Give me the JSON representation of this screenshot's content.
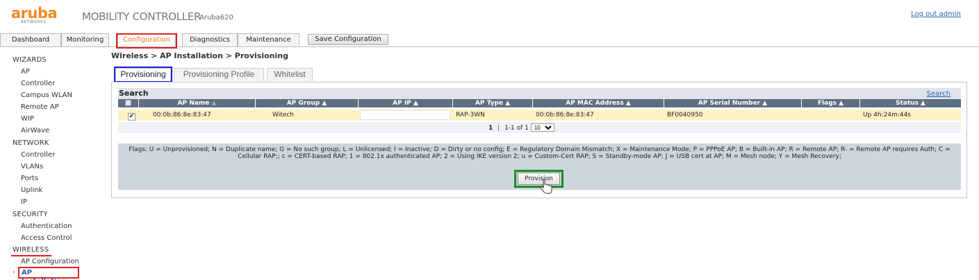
{
  "header": {
    "logo_text": "aruba",
    "logo_subtext": "NETWORKS",
    "product": "MOBILITY CONTROLLER",
    "separator": "|",
    "hostname": "Aruba620",
    "logout": "Log out admin"
  },
  "top_tabs": [
    "Dashboard",
    "Monitoring",
    "Configuration",
    "Diagnostics",
    "Maintenance"
  ],
  "save_button": "Save Configuration",
  "sidebar": {
    "wizards": {
      "title": "WIZARDS",
      "items": [
        "AP",
        "Controller",
        "Campus WLAN",
        "Remote AP",
        "WIP",
        "AirWave"
      ]
    },
    "network": {
      "title": "NETWORK",
      "items": [
        "Controller",
        "VLANs",
        "Ports",
        "Uplink",
        "IP"
      ]
    },
    "security": {
      "title": "SECURITY",
      "items": [
        "Authentication",
        "Access Control"
      ]
    },
    "wireless": {
      "title": "WIRELESS",
      "items": [
        "AP Configuration",
        "AP Installation"
      ]
    },
    "active_arrow": "›"
  },
  "breadcrumb": "Wireless > AP Installation > Provisioning",
  "sub_tabs": [
    "Provisioning",
    "Provisioning Profile",
    "Whitelist"
  ],
  "search": {
    "title": "Search",
    "link": "Search"
  },
  "table": {
    "columns": [
      "AP Name",
      "AP Group ▲",
      "AP IP ▲",
      "AP Type ▲",
      "AP MAC Address ▲",
      "AP Serial Number ▲",
      "Flags ▲",
      "Status ▲"
    ],
    "sort_indicator": "▲",
    "rows": [
      {
        "checked": "✔",
        "ap_name": "00:0b:86:8e:83:47",
        "ap_group": "Witech",
        "ap_ip": "",
        "ap_type": "RAP-3WN",
        "ap_mac": "00:0b:86:8e:83:47",
        "serial": "BF0040950",
        "flags": "",
        "status": "Up 4h:24m:44s"
      }
    ],
    "pager": {
      "page": "1",
      "sep": "|",
      "range": "1-1 of 1",
      "page_size": "10"
    }
  },
  "flags_legend": "Flags: U = Unprovisioned; N = Duplicate name; G = No such group; L = Unlicensed; I = Inactive; D = Dirty or no config; E = Regulatory Domain Mismatch; X = Maintenance Mode; P = PPPoE AP; B = Built-in AP; R = Remote AP; R- = Remote AP requires Auth; C = Cellular RAP;; c = CERT-based RAP; 1 = 802.1x authenticated AP; 2 = Using IKE version 2; u = Custom-Cert RAP; S = Standby-mode AP; J = USB cert at AP; M = Mesh node; Y = Mesh Recovery;",
  "provision_button": "Provision",
  "colors": {
    "accent": "#e8771a",
    "link": "#2a63b5",
    "highlight_red": "#e0211f",
    "highlight_blue": "#1c1ce6",
    "highlight_green": "#1d8c23",
    "table_header": "#5f6e80",
    "row_highlight": "#fbf3c4"
  }
}
